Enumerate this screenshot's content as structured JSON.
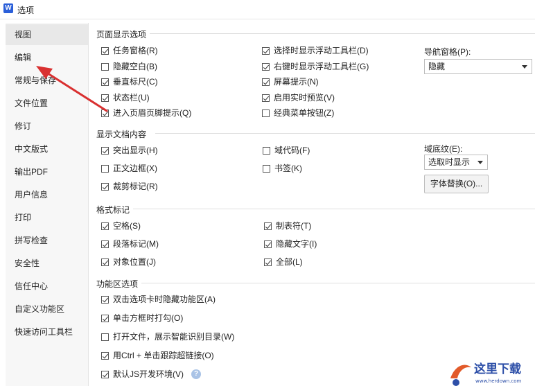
{
  "window": {
    "title": "选项",
    "app_icon_letter": "W"
  },
  "sidebar": {
    "items": [
      {
        "label": "视图"
      },
      {
        "label": "编辑"
      },
      {
        "label": "常规与保存"
      },
      {
        "label": "文件位置"
      },
      {
        "label": "修订"
      },
      {
        "label": "中文版式"
      },
      {
        "label": "输出PDF"
      },
      {
        "label": "用户信息"
      },
      {
        "label": "打印"
      },
      {
        "label": "拼写检查"
      },
      {
        "label": "安全性"
      },
      {
        "label": "信任中心"
      },
      {
        "label": "自定义功能区"
      },
      {
        "label": "快速访问工具栏"
      }
    ],
    "active_index": 0
  },
  "page_display": {
    "title": "页面显示选项",
    "col1": [
      {
        "label": "任务窗格(R)",
        "checked": true
      },
      {
        "label": "隐藏空白(B)",
        "checked": false
      },
      {
        "label": "垂直标尺(C)",
        "checked": true
      },
      {
        "label": "状态栏(U)",
        "checked": true
      },
      {
        "label": "进入页眉页脚提示(Q)",
        "checked": true
      }
    ],
    "col2": [
      {
        "label": "选择时显示浮动工具栏(D)",
        "checked": true
      },
      {
        "label": "右键时显示浮动工具栏(G)",
        "checked": true
      },
      {
        "label": "屏幕提示(N)",
        "checked": true
      },
      {
        "label": "启用实时预览(V)",
        "checked": true
      },
      {
        "label": "经典菜单按钮(Z)",
        "checked": false
      }
    ],
    "nav_pane_label": "导航窗格(P):",
    "nav_pane_value": "隐藏"
  },
  "doc_content": {
    "title": "显示文档内容",
    "col1": [
      {
        "label": "突出显示(H)",
        "checked": true
      },
      {
        "label": "正文边框(X)",
        "checked": false
      },
      {
        "label": "裁剪标记(R)",
        "checked": true
      }
    ],
    "col2": [
      {
        "label": "域代码(F)",
        "checked": false
      },
      {
        "label": "书签(K)",
        "checked": false
      }
    ],
    "field_shading_label": "域底纹(E):",
    "field_shading_value": "选取时显示",
    "font_replace_button": "字体替换(O)..."
  },
  "format_marks": {
    "title": "格式标记",
    "col1": [
      {
        "label": "空格(S)",
        "checked": true
      },
      {
        "label": "段落标记(M)",
        "checked": true
      },
      {
        "label": "对象位置(J)",
        "checked": true
      }
    ],
    "col2": [
      {
        "label": "制表符(T)",
        "checked": true
      },
      {
        "label": "隐藏文字(I)",
        "checked": true
      },
      {
        "label": "全部(L)",
        "checked": true
      }
    ]
  },
  "ribbon": {
    "title": "功能区选项",
    "items": [
      {
        "label": "双击选项卡时隐藏功能区(A)",
        "checked": true
      },
      {
        "label": "单击方框时打勾(O)",
        "checked": true
      },
      {
        "label": "打开文件，展示智能识别目录(W)",
        "checked": false
      },
      {
        "label": "用Ctrl + 单击跟踪超链接(O)",
        "checked": true
      },
      {
        "label": "默认JS开发环境(V)",
        "checked": true
      }
    ]
  },
  "colors": {
    "arrow": "#d93030",
    "help_icon": "#a9c3e6"
  },
  "watermark": {
    "text": "这里下载",
    "url": "www.herdown.com"
  }
}
